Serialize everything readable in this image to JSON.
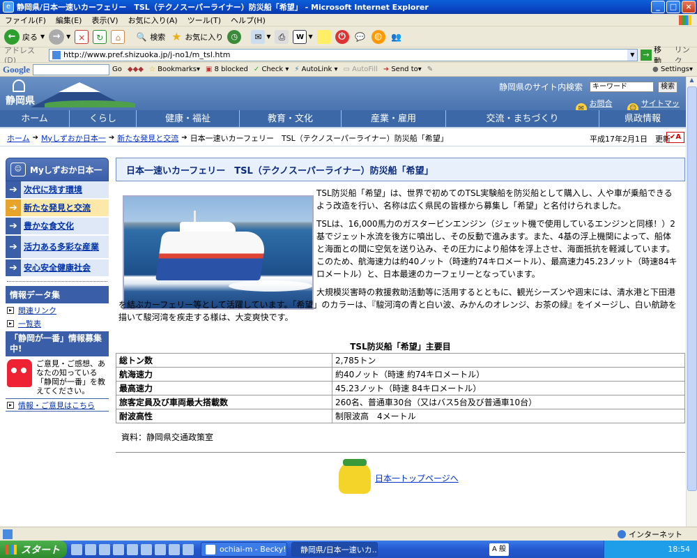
{
  "window": {
    "title": "静岡県/日本一速いカーフェリー　TSL（テクノスーパーライナー）防災船「希望」 - Microsoft Internet Explorer"
  },
  "menu": [
    "ファイル(F)",
    "編集(E)",
    "表示(V)",
    "お気に入り(A)",
    "ツール(T)",
    "ヘルプ(H)"
  ],
  "toolbar": {
    "back": "戻る",
    "search": "検索",
    "favorites": "お気に入り"
  },
  "address": {
    "label": "アドレス(D)",
    "url": "http://www.pref.shizuoka.jp/j-no1/m_tsl.htm",
    "go": "移動",
    "links": "リンク"
  },
  "googlebar": {
    "logo": "Google",
    "go": "Go",
    "bookmarks": "Bookmarks▾",
    "blocked": "8 blocked",
    "check": "Check",
    "autolink": "AutoLink",
    "autofill": "AutoFill",
    "sendto": "Send to▾",
    "settings": "Settings▾"
  },
  "site": {
    "logo_text": "静岡県",
    "search_label": "静岡県のサイト内検索",
    "search_value": "キーワード",
    "search_button": "検索",
    "contact": "お問合せ",
    "sitemap": "サイトマップ",
    "nav": [
      "ホーム",
      "くらし",
      "健康・福祉",
      "教育・文化",
      "産業・雇用",
      "交流・まちづくり",
      "県政情報"
    ]
  },
  "breadcrumb": {
    "items": [
      "ホーム",
      "Myしずおか日本一",
      "新たな発見と交流"
    ],
    "current": "日本一速いカーフェリー　TSL（テクノスーパーライナー）防災船「希望」",
    "date": "平成17年2月1日　更新",
    "size_button": "A"
  },
  "sidebar": {
    "header": "Myしずおか日本一",
    "items": [
      "次代に残す環境",
      "新たな発見と交流",
      "豊かな食文化",
      "活力ある多彩な産業",
      "安心安全健康社会"
    ],
    "data_header": "情報データ集",
    "data_links": [
      "関連リンク",
      "一覧表"
    ],
    "ichiban_header": "「静岡が一番」情報募集中!",
    "ichiban_text": "ご意見・ご感想、あなたの知っている「静岡が一番」を教えてください。",
    "ichiban_link": "情報・ご意見はこちら"
  },
  "main": {
    "title": "日本一速いカーフェリー　TSL（テクノスーパーライナー）防災船「希望」",
    "p1": "TSL防災船「希望」は、世界で初めてのTSL実験船を防災船として購入し、人や車が乗船できるよう改造を行い、名称は広く県民の皆様から募集し「希望」と名付けられました。",
    "p2": "TSLは、16,000馬力のガスタービンエンジン（ジェット機で使用しているエンジンと同様！）2基でジェット水流を後方に噴出し、その反動で進みます。また、4基の浮上機関によって、船体と海面との間に空気を送り込み、その圧力により船体を浮上させ、海面抵抗を軽減しています。このため、航海速力は約40ノット（時速約74キロメートル）、最高速力45.23ノット（時速84キロメートル）と、日本最速のカーフェリーとなっています。",
    "p3": "大規模災害時の救援救助活動等に活用するとともに、観光シーズンや週末には、清水港と下田港を結ぶカーフェリー等として活躍しています。「希望」のカラーは、『駿河湾の青と白い波、みかんのオレンジ、お茶の緑』をイメージし、白い航跡を描いて駿河湾を疾走する様は、大変爽快です。",
    "table_caption": "TSL防災船「希望」主要目",
    "table": [
      {
        "k": "総トン数",
        "v": "2,785トン"
      },
      {
        "k": "航海速力",
        "v": "約40ノット（時速 約74キロメートル）"
      },
      {
        "k": "最高速力",
        "v": "45.23ノット（時速 84キロメートル）"
      },
      {
        "k": "旅客定員及び車両最大搭載数",
        "v": "260名、普通車30台（又はバス5台及び普通車10台）"
      },
      {
        "k": "耐波高性",
        "v": "制限波高　4メートル"
      }
    ],
    "source": "資料：静岡県交通政策室",
    "top_link": "日本一トップページへ"
  },
  "status": {
    "zone": "インターネット"
  },
  "taskbar": {
    "start": "スタート",
    "tasks": [
      "ochiai-m - Becky!",
      "静岡県/日本一速いカ..."
    ],
    "clock": "18:54",
    "ime": "A 般"
  }
}
